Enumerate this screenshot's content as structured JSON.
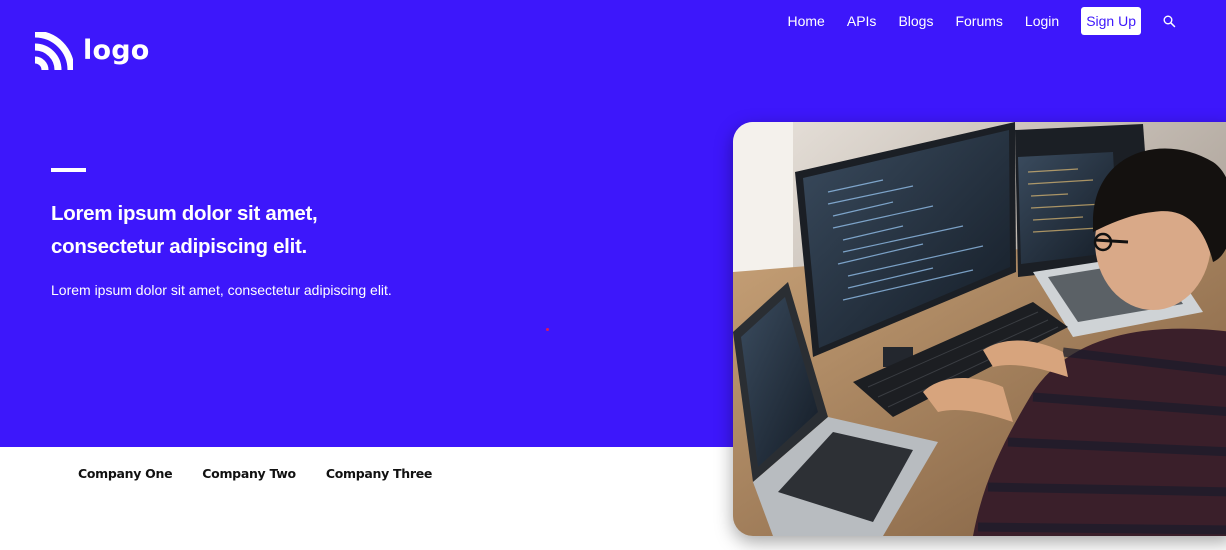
{
  "brand": {
    "logo_text": "logo",
    "icon": "rss-waves-icon"
  },
  "nav": {
    "links": [
      "Home",
      "APIs",
      "Blogs",
      "Forums",
      "Login"
    ],
    "signup_label": "Sign Up",
    "search_icon": "search-icon"
  },
  "hero": {
    "headline_line1": "Lorem ipsum dolor sit amet,",
    "headline_line2": "consectetur adipiscing elit.",
    "subtext": "Lorem ipsum dolor sit amet, consectetur adipiscing elit.",
    "image_icon": "developer-at-computer-photo"
  },
  "companies": [
    "Company One",
    "Company Two",
    "Company Three"
  ],
  "colors": {
    "primary": "#3d17fb",
    "white": "#ffffff",
    "text_dark": "#111111"
  }
}
